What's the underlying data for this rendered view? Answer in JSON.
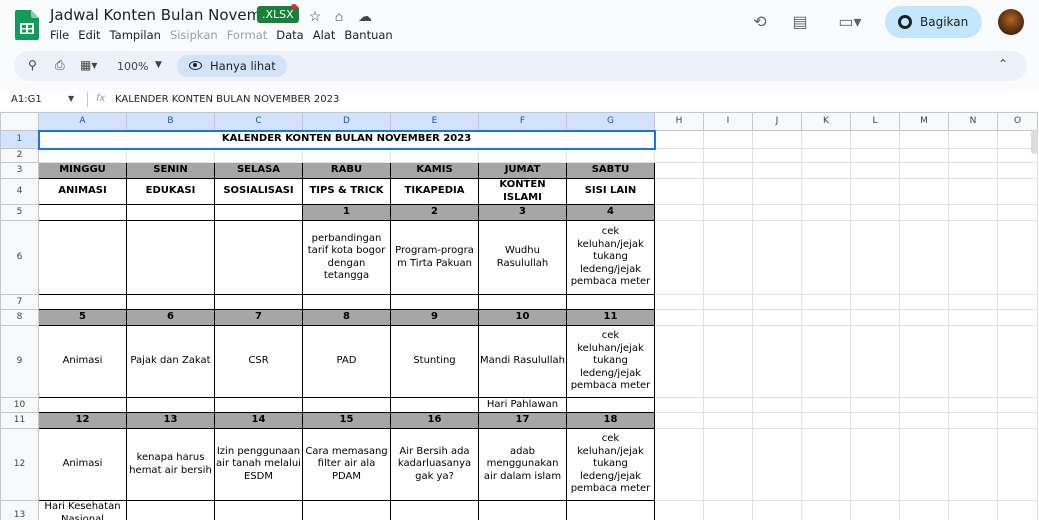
{
  "app": {
    "doc_title": "Jadwal Konten Bulan November",
    "file_badge": ".XLSX",
    "menu": [
      "File",
      "Edit",
      "Tampilan",
      "Sisipkan",
      "Format",
      "Data",
      "Alat",
      "Bantuan"
    ],
    "menu_disabled": [
      false,
      false,
      false,
      true,
      true,
      false,
      false,
      false
    ],
    "share_label": "Bagikan"
  },
  "toolbar": {
    "zoom": "100%",
    "view_mode": "Hanya lihat"
  },
  "formula_bar": {
    "cell_ref": "A1:G1",
    "fx": "fx",
    "value": "KALENDER KONTEN BULAN NOVEMBER 2023"
  },
  "columns": [
    "A",
    "B",
    "C",
    "D",
    "E",
    "F",
    "G",
    "H",
    "I",
    "J",
    "K",
    "L",
    "M",
    "N",
    "O"
  ],
  "rows": [
    "1",
    "2",
    "3",
    "4",
    "5",
    "6",
    "7",
    "8",
    "9",
    "10",
    "11",
    "12",
    "13"
  ],
  "sheet": {
    "title": "KALENDER KONTEN BULAN NOVEMBER 2023",
    "days": [
      "MINGGU",
      "SENIN",
      "SELASA",
      "RABU",
      "KAMIS",
      "JUMAT",
      "SABTU"
    ],
    "themes": [
      "ANIMASI",
      "EDUKASI",
      "SOSIALISASI",
      "TIPS & TRICK",
      "TIKAPEDIA",
      "KONTEN ISLAMI",
      "SISI LAIN"
    ],
    "week1_dates": [
      "",
      "",
      "",
      "1",
      "2",
      "3",
      "4"
    ],
    "week1_content": [
      "",
      "",
      "",
      "perbandingan tarif kota bogor dengan tetangga",
      "Program-progra m Tirta Pakuan",
      "Wudhu Rasulullah",
      "cek keluhan/jejak tukang ledeng/jejak pembaca meter"
    ],
    "week2_dates": [
      "5",
      "6",
      "7",
      "8",
      "9",
      "10",
      "11"
    ],
    "week2_content": [
      "Animasi",
      "Pajak dan Zakat",
      "CSR",
      "PAD",
      "Stunting",
      "Mandi Rasulullah",
      "cek keluhan/jejak tukang ledeng/jejak pembaca meter"
    ],
    "row10_note_F": "Hari Pahlawan",
    "week3_dates": [
      "12",
      "13",
      "14",
      "15",
      "16",
      "17",
      "18"
    ],
    "week3_content": [
      "Animasi",
      "kenapa harus hemat air bersih",
      "Izin penggunaan air tanah melalui ESDM",
      "Cara memasang filter air ala PDAM",
      "Air Bersih ada kadarluasanya gak ya?",
      "adab menggunakan air dalam islam",
      "cek keluhan/jejak tukang ledeng/jejak pembaca meter"
    ],
    "row13_A": "Hari Kesehatan Nasional"
  }
}
